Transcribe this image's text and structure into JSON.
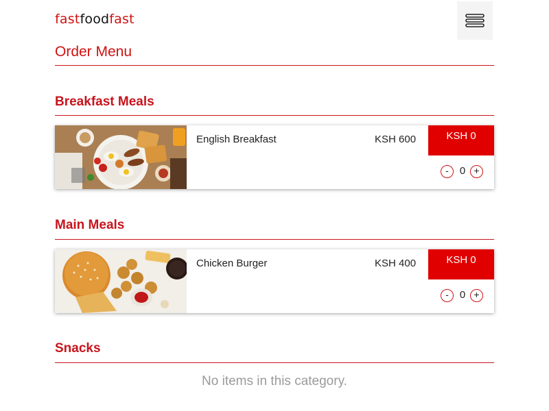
{
  "brand": {
    "part1": "fast",
    "part2": "food",
    "part3": "fast"
  },
  "header": {
    "menu_icon": "hamburger-menu-icon"
  },
  "page": {
    "title": "Order Menu"
  },
  "sections": [
    {
      "title": "Breakfast Meals",
      "items": [
        {
          "name": "English Breakfast",
          "price": "KSH 600",
          "total": "KSH 0",
          "decrement": "-",
          "quantity": "0",
          "increment": "+"
        }
      ]
    },
    {
      "title": "Main Meals",
      "items": [
        {
          "name": "Chicken Burger",
          "price": "KSH 400",
          "total": "KSH 0",
          "decrement": "-",
          "quantity": "0",
          "increment": "+"
        }
      ]
    },
    {
      "title": "Snacks",
      "empty_text": "No items in this category."
    }
  ],
  "colors": {
    "accent": "#d01010",
    "total_bg": "#e00000",
    "empty_text": "#9a9a9a"
  }
}
